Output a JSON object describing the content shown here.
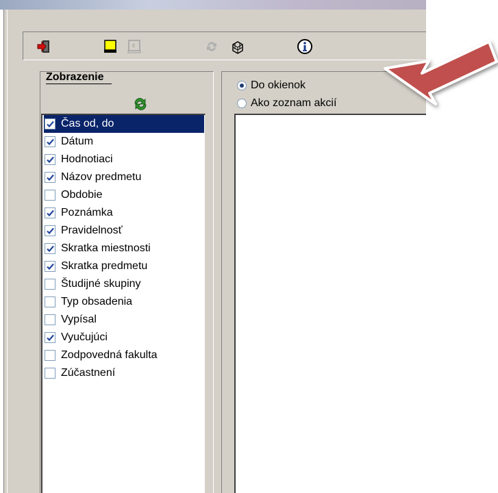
{
  "panel": {
    "title": "Zobrazenie"
  },
  "toolbar": {
    "icons": [
      "exit-icon",
      "document-yellow-icon",
      "document-disabled-icon",
      "refresh-disabled-icon",
      "cube-grid-icon",
      "info-icon"
    ]
  },
  "columns": [
    {
      "label": "Čas od, do",
      "checked": true,
      "selected": true
    },
    {
      "label": "Dátum",
      "checked": true
    },
    {
      "label": "Hodnotiaci",
      "checked": true
    },
    {
      "label": "Názov predmetu",
      "checked": true
    },
    {
      "label": "Obdobie",
      "checked": false
    },
    {
      "label": "Poznámka",
      "checked": true
    },
    {
      "label": "Pravidelnosť",
      "checked": true
    },
    {
      "label": "Skratka miestnosti",
      "checked": true
    },
    {
      "label": "Skratka predmetu",
      "checked": true
    },
    {
      "label": "Študijné skupiny",
      "checked": false
    },
    {
      "label": "Typ obsadenia",
      "checked": false
    },
    {
      "label": "Vypísal",
      "checked": false
    },
    {
      "label": "Vyučujúci",
      "checked": true
    },
    {
      "label": "Zodpovedná fakulta",
      "checked": false
    },
    {
      "label": "Zúčastnení",
      "checked": false
    }
  ],
  "display_mode": {
    "options": [
      "Do okienok",
      "Ako zoznam akcií"
    ],
    "selected": "Do okienok"
  },
  "colors": {
    "window_bg": "#d4d0c8",
    "selection": "#0a246a",
    "arrow": "#c0504d"
  }
}
